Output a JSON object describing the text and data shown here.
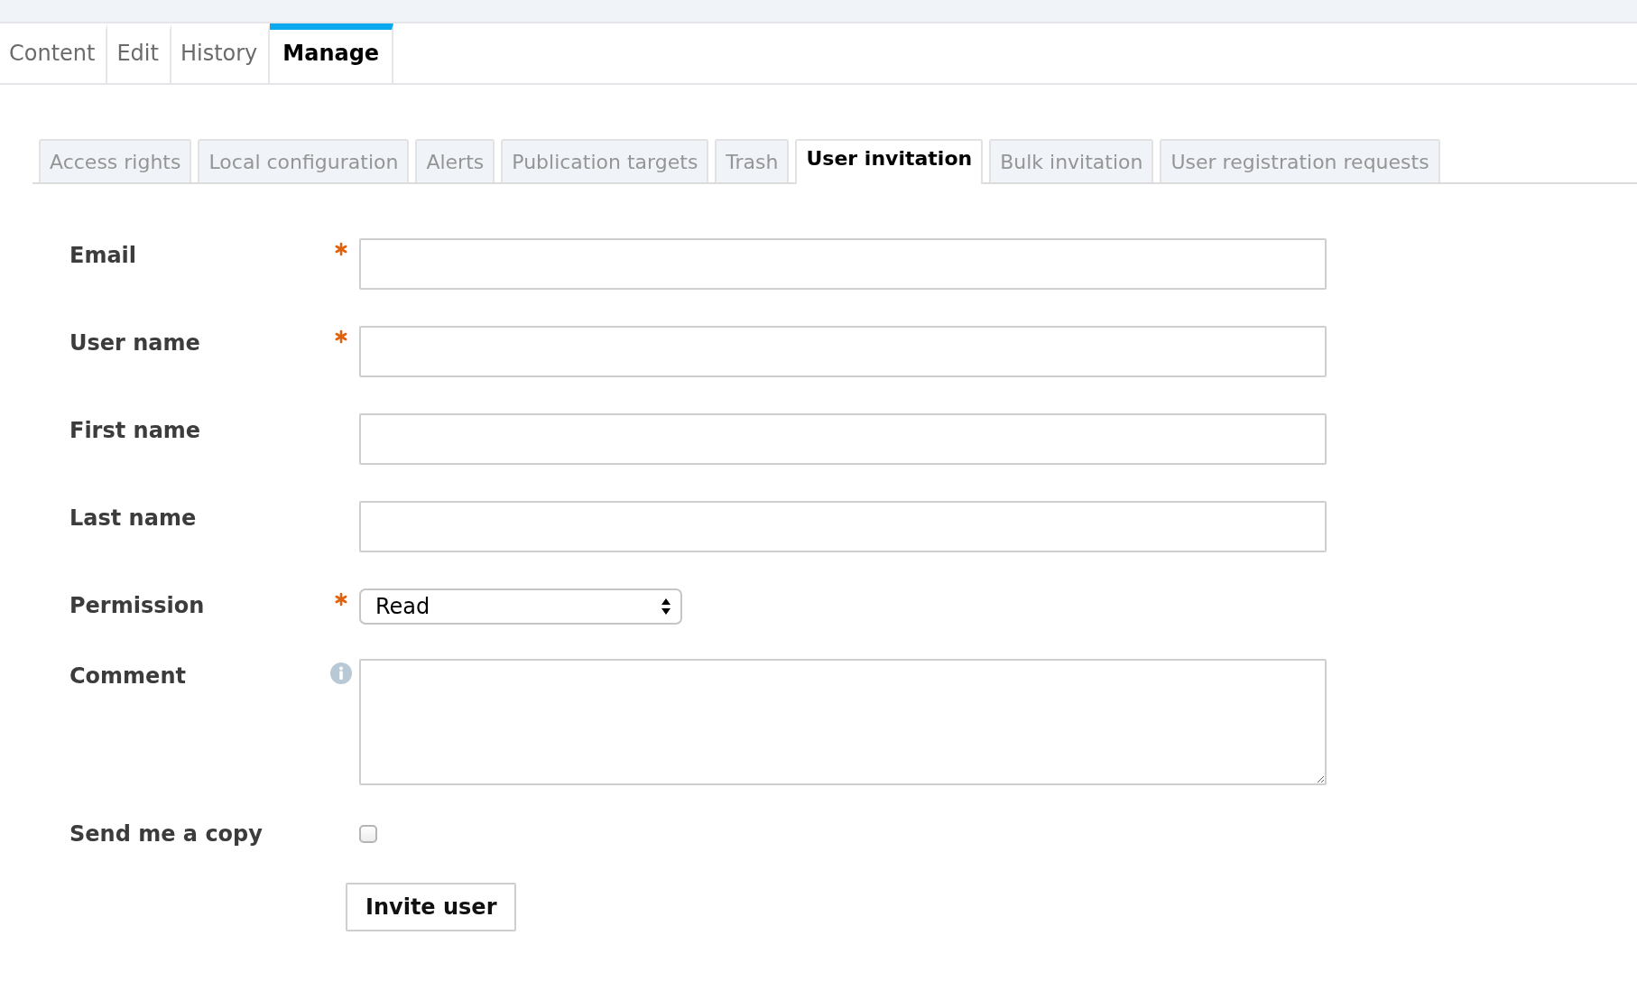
{
  "main_tabs": [
    {
      "label": "Content",
      "selected": false
    },
    {
      "label": "Edit",
      "selected": false
    },
    {
      "label": "History",
      "selected": false
    },
    {
      "label": "Manage",
      "selected": true
    }
  ],
  "sub_tabs": [
    {
      "label": "Access rights",
      "selected": false
    },
    {
      "label": "Local configuration",
      "selected": false
    },
    {
      "label": "Alerts",
      "selected": false
    },
    {
      "label": "Publication targets",
      "selected": false
    },
    {
      "label": "Trash",
      "selected": false
    },
    {
      "label": "User invitation",
      "selected": true
    },
    {
      "label": "Bulk invitation",
      "selected": false
    },
    {
      "label": "User registration requests",
      "selected": false
    }
  ],
  "form": {
    "fields": [
      {
        "kind": "text",
        "label": "Email",
        "required": true,
        "info": false
      },
      {
        "kind": "text",
        "label": "User name",
        "required": true,
        "info": false
      },
      {
        "kind": "text",
        "label": "First name",
        "required": false,
        "info": false
      },
      {
        "kind": "text",
        "label": "Last name",
        "required": false,
        "info": false
      },
      {
        "kind": "select",
        "label": "Permission",
        "required": true,
        "info": false,
        "value": "Read"
      },
      {
        "kind": "textarea",
        "label": "Comment",
        "required": false,
        "info": true
      },
      {
        "kind": "checkbox",
        "label": "Send me a copy",
        "required": false,
        "info": false,
        "checked": false
      }
    ],
    "submit": "Invite user"
  }
}
